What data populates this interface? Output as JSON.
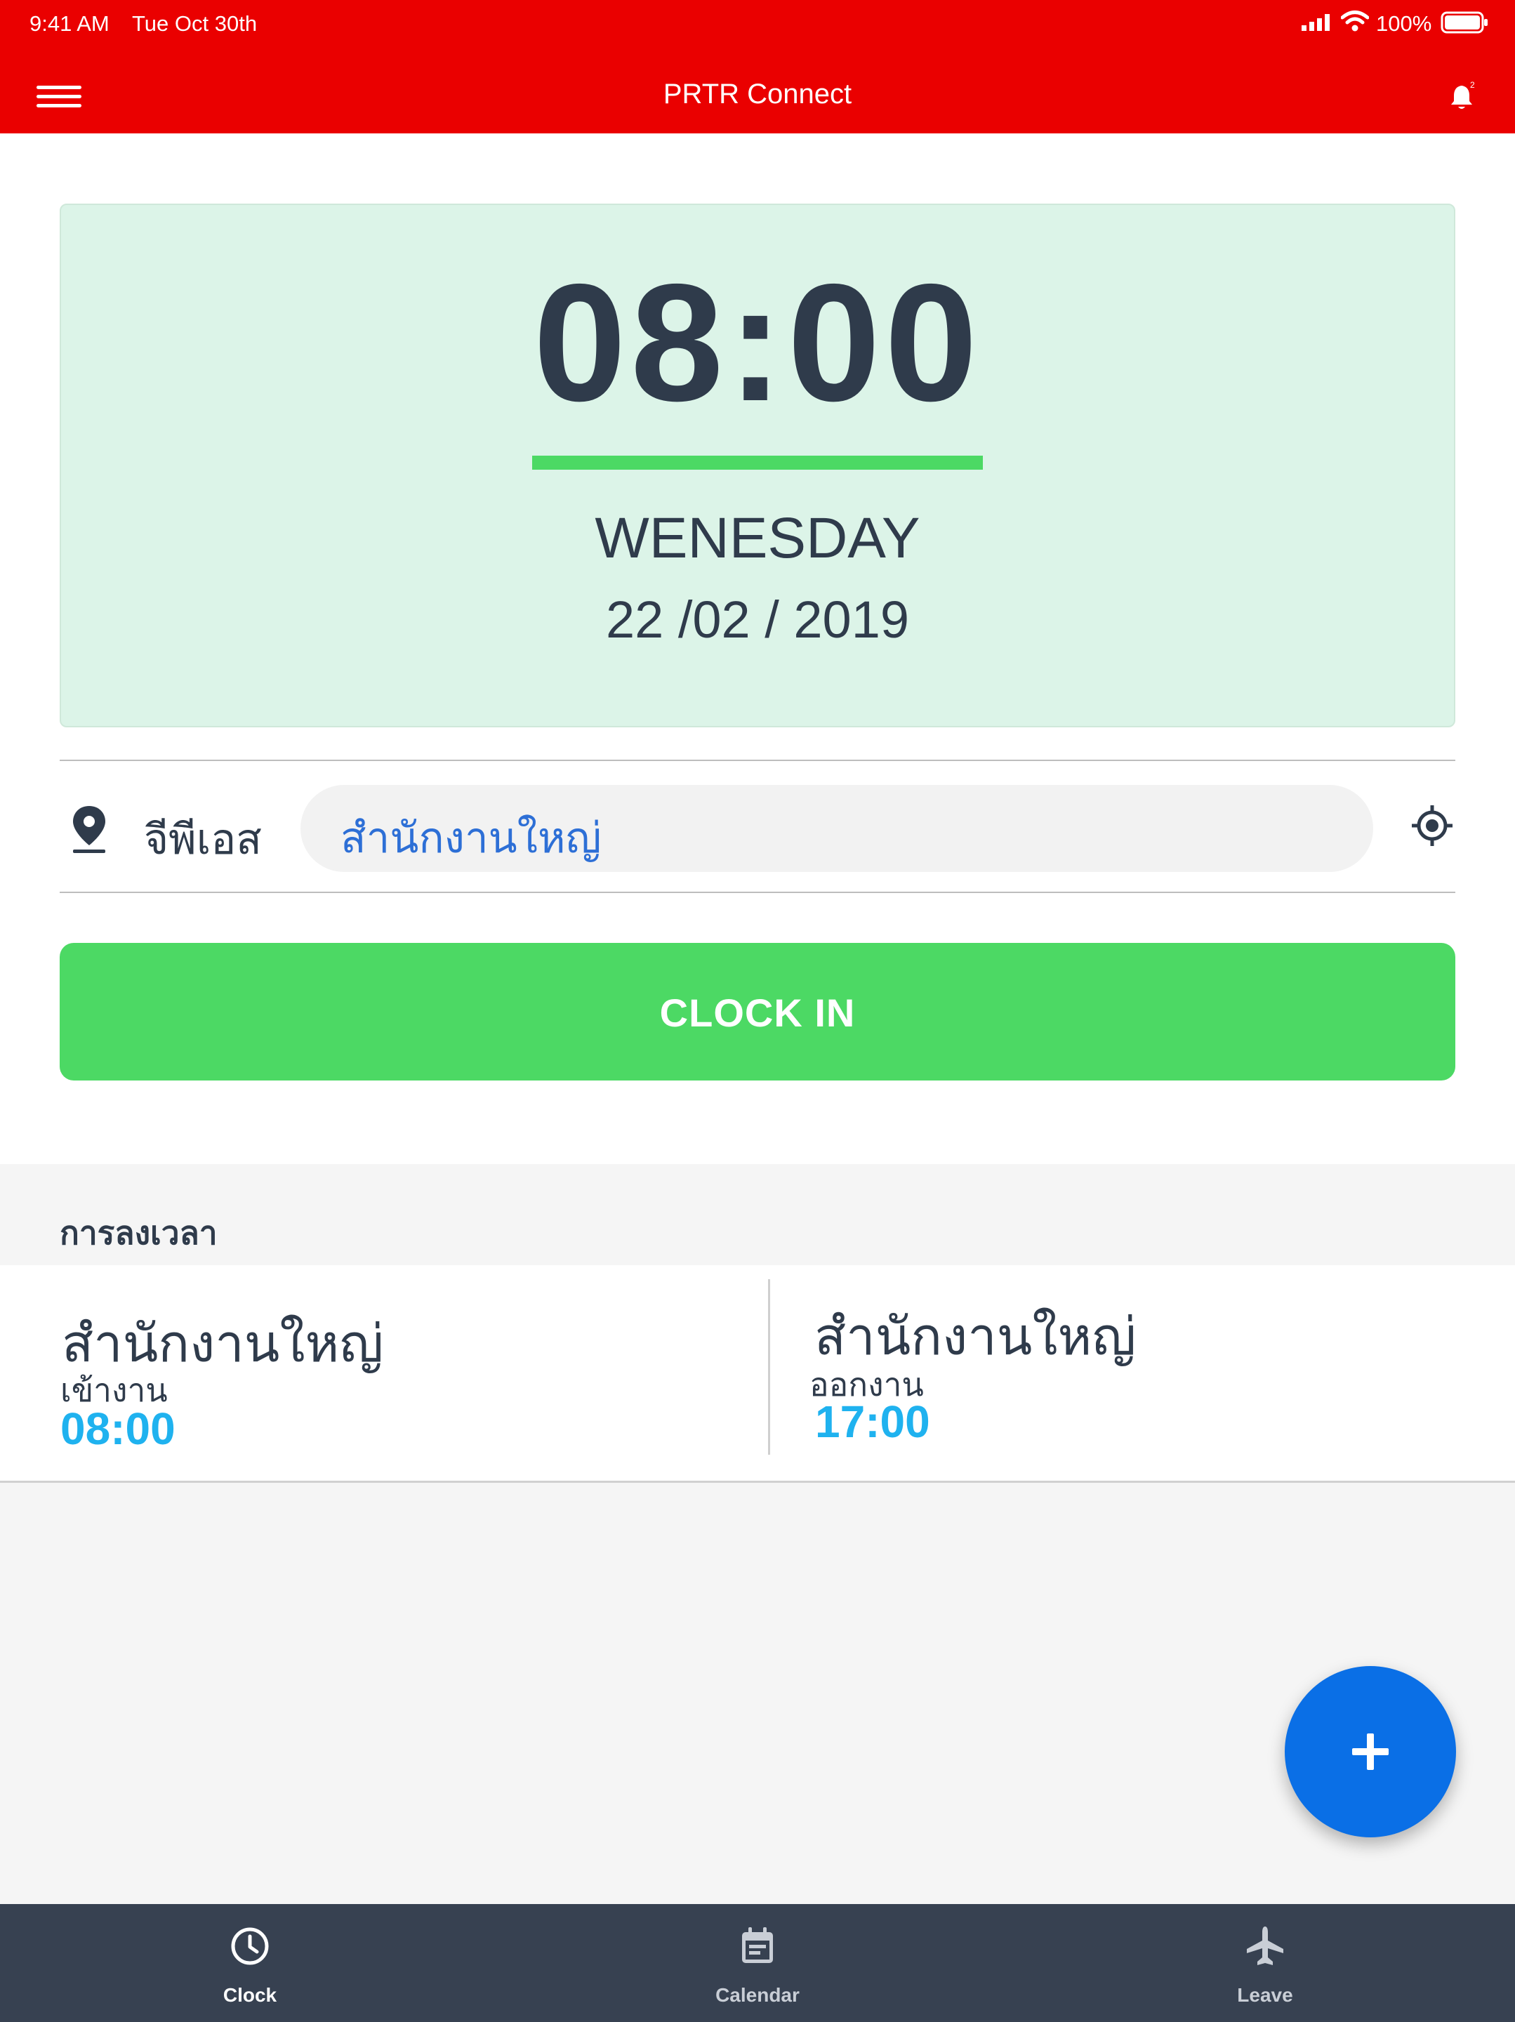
{
  "status_bar": {
    "time": "9:41 AM",
    "date": "Tue Oct 30th",
    "battery": "100%"
  },
  "header": {
    "title": "PRTR Connect",
    "notification_count": "2"
  },
  "clock": {
    "time": "08:00",
    "day": "WENESDAY",
    "date": "22 /02 / 2019"
  },
  "location": {
    "company": "จีพีเอส",
    "value": "สำนักงานใหญ่"
  },
  "actions": {
    "clock_in_label": "CLOCK IN"
  },
  "records": {
    "title": "การลงเวลา",
    "items": [
      {
        "location": "สำนักงานใหญ่",
        "type": "เข้างาน",
        "time": "08:00"
      },
      {
        "location": "สำนักงานใหญ่",
        "type": "ออกงาน",
        "time": "17:00"
      }
    ]
  },
  "bottom_nav": {
    "items": [
      {
        "label": "Clock",
        "icon": "clock-icon",
        "active": true
      },
      {
        "label": "Calendar",
        "icon": "calendar-icon",
        "active": false
      },
      {
        "label": "Leave",
        "icon": "airplane-icon",
        "active": false
      }
    ]
  },
  "colors": {
    "header": "#ea0000",
    "primary_green": "#4cd964",
    "card_bg": "#dcf4e8",
    "link_blue": "#2d6fd6",
    "time_blue": "#1fb2ef",
    "fab": "#0a6fe6",
    "nav_bg": "#374151"
  }
}
